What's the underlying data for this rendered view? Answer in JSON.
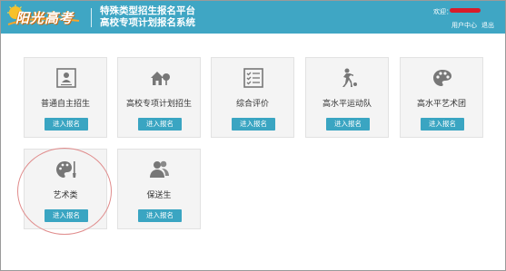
{
  "header": {
    "logo_text": "阳光高考",
    "title_line1": "特殊类型招生报名平台",
    "title_line2": "高校专项计划报名系统",
    "welcome": "欢迎：",
    "user_center": "用户中心",
    "logout": "退出"
  },
  "cards": [
    {
      "label": "普通自主招生",
      "button": "进入报名",
      "icon": "id-card-icon"
    },
    {
      "label": "高校专项计划招生",
      "button": "进入报名",
      "icon": "house-tree-icon"
    },
    {
      "label": "综合评价",
      "button": "进入报名",
      "icon": "checklist-icon"
    },
    {
      "label": "高水平运动队",
      "button": "进入报名",
      "icon": "athlete-icon"
    },
    {
      "label": "高水平艺术团",
      "button": "进入报名",
      "icon": "palette-icon"
    },
    {
      "label": "艺术类",
      "button": "进入报名",
      "icon": "palette-brush-icon"
    },
    {
      "label": "保送生",
      "button": "进入报名",
      "icon": "people-icon"
    }
  ],
  "colors": {
    "header_bg": "#3fa6c4",
    "button_bg": "#3aa5c2",
    "card_bg": "#f4f4f4",
    "highlight_circle": "#e08c8c",
    "redaction": "#d81c2a"
  }
}
